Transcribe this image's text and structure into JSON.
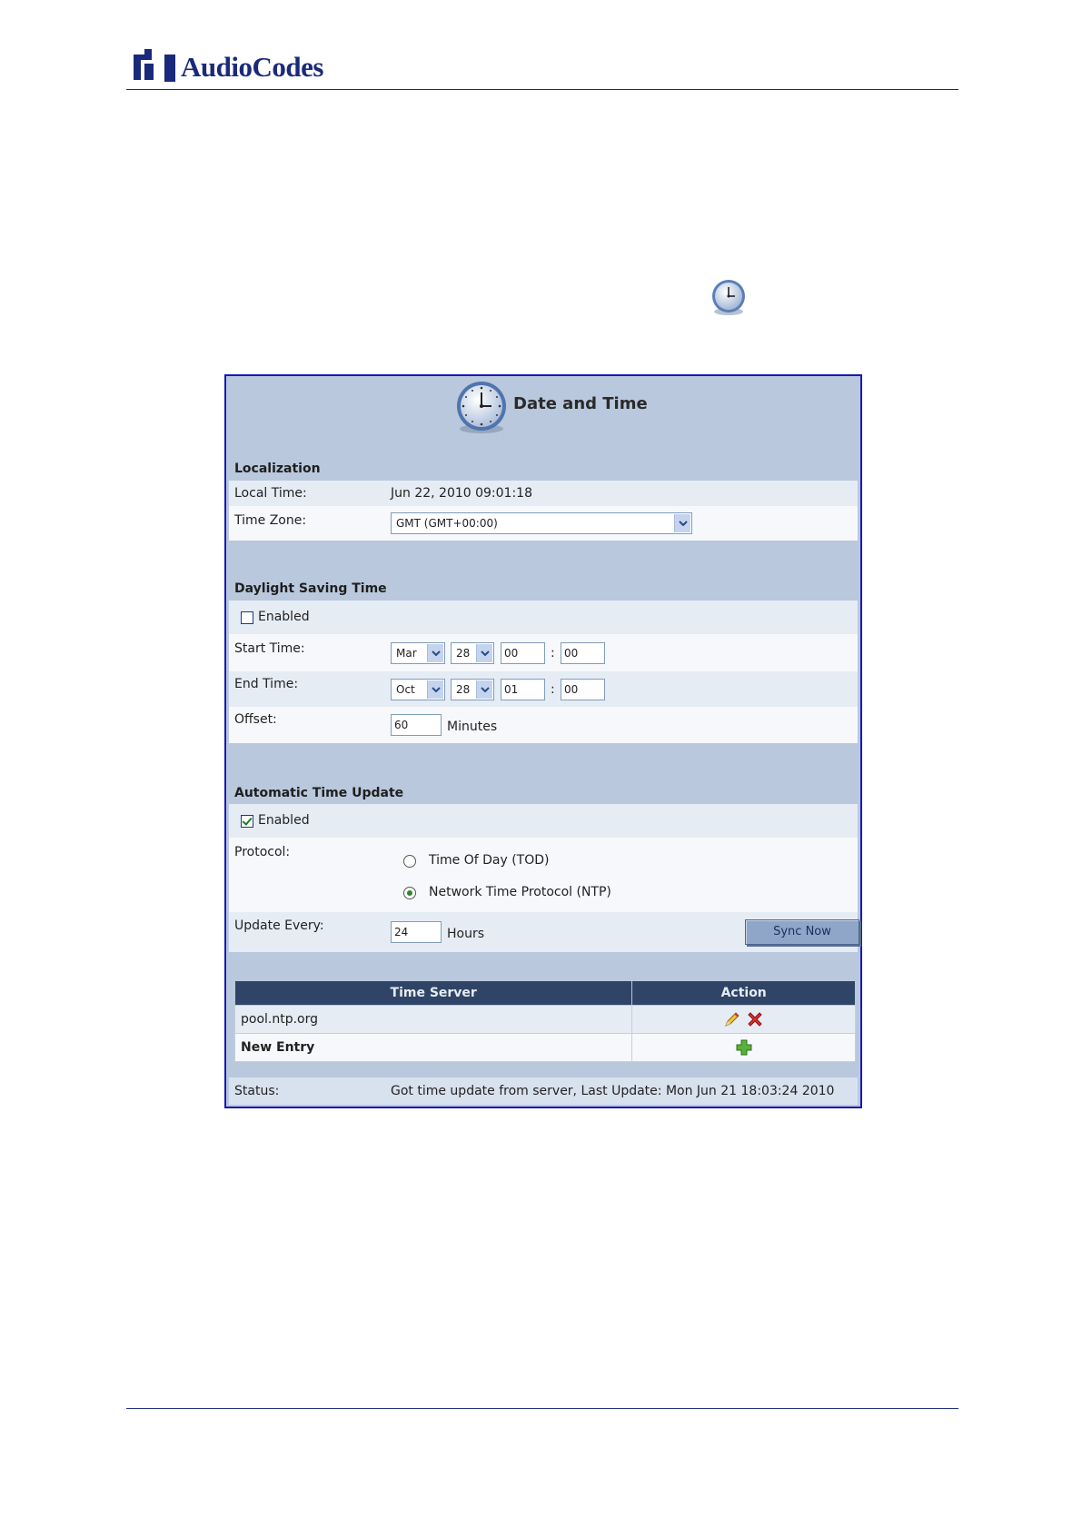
{
  "header": {
    "brand": "AudioCodes"
  },
  "panel": {
    "title": "Date and Time",
    "localization": {
      "heading": "Localization",
      "local_time_label": "Local Time:",
      "local_time_value": "Jun 22, 2010 09:01:18",
      "time_zone_label": "Time Zone:",
      "time_zone_value": "GMT (GMT+00:00)"
    },
    "dst": {
      "heading": "Daylight Saving Time",
      "enabled_label": "Enabled",
      "enabled": false,
      "start_label": "Start Time:",
      "start": {
        "month": "Mar",
        "day": "28",
        "hour": "00",
        "minute": "00"
      },
      "end_label": "End Time:",
      "end": {
        "month": "Oct",
        "day": "28",
        "hour": "01",
        "minute": "00"
      },
      "colon": ":",
      "offset_label": "Offset:",
      "offset_value": "60",
      "offset_unit": "Minutes"
    },
    "auto_update": {
      "heading": "Automatic Time Update",
      "enabled_label": "Enabled",
      "enabled": true,
      "protocol_label": "Protocol:",
      "protocol_options": [
        "Time Of Day (TOD)",
        "Network Time Protocol (NTP)"
      ],
      "protocol_selected": "Network Time Protocol (NTP)",
      "update_every_label": "Update Every:",
      "update_every_value": "24",
      "update_every_unit": "Hours",
      "sync_button": "Sync Now"
    },
    "servers_table": {
      "columns": [
        "Time Server",
        "Action"
      ],
      "rows": [
        {
          "server": "pool.ntp.org"
        }
      ],
      "new_entry_label": "New Entry"
    },
    "status": {
      "label": "Status:",
      "value": "Got time update from server, Last Update: Mon Jun 21 18:03:24 2010"
    }
  },
  "icons": [
    "audiocodes-logo-icon",
    "clock-icon",
    "edit-icon",
    "delete-icon",
    "add-icon",
    "chevron-down-icon"
  ],
  "colors": {
    "brand": "#1a2a7a",
    "panel_bg": "#b9c8dc",
    "table_header": "#2f4466",
    "status_ok": "#2a8a2a"
  }
}
